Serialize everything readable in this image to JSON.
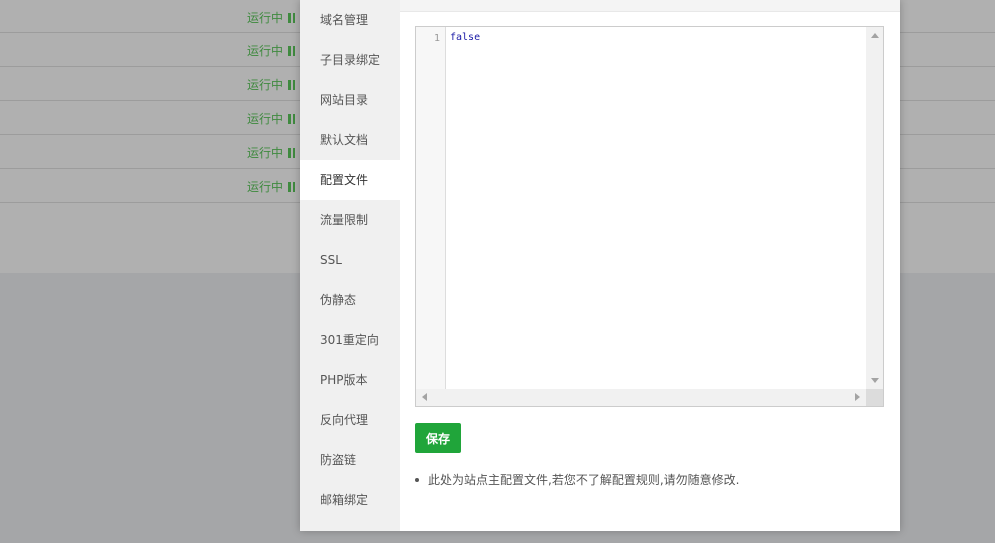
{
  "background": {
    "rows": [
      {
        "status": "运行中"
      },
      {
        "status": "运行中"
      },
      {
        "status": "运行中"
      },
      {
        "status": "运行中"
      },
      {
        "status": "运行中"
      },
      {
        "status": "运行中"
      }
    ],
    "status_color": "#3f8a3f"
  },
  "sidebar": {
    "items": [
      {
        "label": "域名管理"
      },
      {
        "label": "子目录绑定"
      },
      {
        "label": "网站目录"
      },
      {
        "label": "默认文档"
      },
      {
        "label": "配置文件"
      },
      {
        "label": "流量限制"
      },
      {
        "label": "SSL"
      },
      {
        "label": "伪静态"
      },
      {
        "label": "301重定向"
      },
      {
        "label": "PHP版本"
      },
      {
        "label": "反向代理"
      },
      {
        "label": "防盗链"
      },
      {
        "label": "邮箱绑定"
      }
    ],
    "active": "配置文件"
  },
  "editor": {
    "line_number": "1",
    "content": "false"
  },
  "save_label": "保存",
  "save_color": "#20a53a",
  "note": "此处为站点主配置文件,若您不了解配置规则,请勿随意修改."
}
